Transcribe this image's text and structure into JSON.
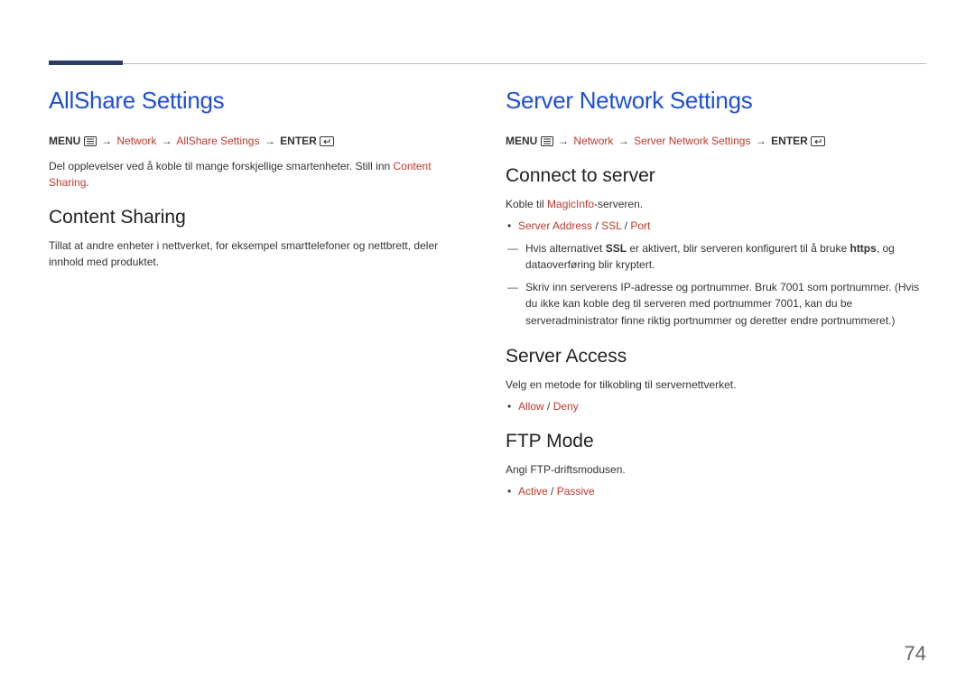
{
  "page_number": "74",
  "left": {
    "title": "AllShare Settings",
    "nav": {
      "menu": "MENU",
      "arrow": "→",
      "path1": "Network",
      "path2": "AllShare Settings",
      "enter": "ENTER"
    },
    "intro_a": "Del opplevelser ved å koble til mange forskjellige smartenheter. Still inn ",
    "intro_red": "Content Sharing",
    "intro_b": ".",
    "h2": "Content Sharing",
    "p1": "Tillat at andre enheter i nettverket, for eksempel smarttelefoner og nettbrett, deler innhold med produktet."
  },
  "right": {
    "title": "Server Network Settings",
    "nav": {
      "menu": "MENU",
      "arrow": "→",
      "path1": "Network",
      "path2": "Server Network Settings",
      "enter": "ENTER"
    },
    "connect": {
      "h2": "Connect to server",
      "koble_a": "Koble til ",
      "koble_red": "MagicInfo",
      "koble_b": "-serveren.",
      "options": {
        "a": "Server Address",
        "b": "SSL",
        "c": "Port",
        "sep": " / "
      },
      "dash1_a": "Hvis alternativet ",
      "dash1_b": "SSL",
      "dash1_c": " er aktivert, blir serveren konfigurert til å bruke ",
      "dash1_d": "https",
      "dash1_e": ", og dataoverføring blir kryptert.",
      "dash2": "Skriv inn serverens IP-adresse og portnummer. Bruk 7001 som portnummer. (Hvis du ikke kan koble deg til serveren med portnummer 7001, kan du be serveradministrator finne riktig portnummer og deretter endre portnummeret.)"
    },
    "access": {
      "h2": "Server Access",
      "p": "Velg en metode for tilkobling til servernettverket.",
      "options": {
        "a": "Allow",
        "b": "Deny",
        "sep": " / "
      }
    },
    "ftp": {
      "h2": "FTP Mode",
      "p": "Angi FTP-driftsmodusen.",
      "options": {
        "a": "Active",
        "b": "Passive",
        "sep": " / "
      }
    }
  }
}
